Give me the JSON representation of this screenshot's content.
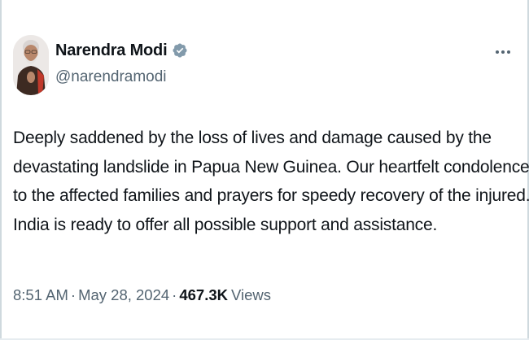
{
  "tweet": {
    "author": {
      "name": "Narendra Modi",
      "handle": "@narendramodi",
      "verified": true,
      "verified_color": "#829aab"
    },
    "more_icon": "more-horizontal-icon",
    "text_lines": [
      "Deeply saddened by the loss of lives and damage caused by the",
      "devastating landslide in Papua New Guinea. Our heartfelt condolences",
      "to the affected families and prayers for speedy recovery of the injured.",
      "India is ready to offer all possible support and assistance."
    ],
    "meta": {
      "time": "8:51 AM",
      "separator": "·",
      "date": "May 28, 2024",
      "views_count": "467.3K",
      "views_label": "Views"
    }
  },
  "colors": {
    "text_primary": "#0f1419",
    "text_secondary": "#536471",
    "border": "#cfd9de"
  }
}
